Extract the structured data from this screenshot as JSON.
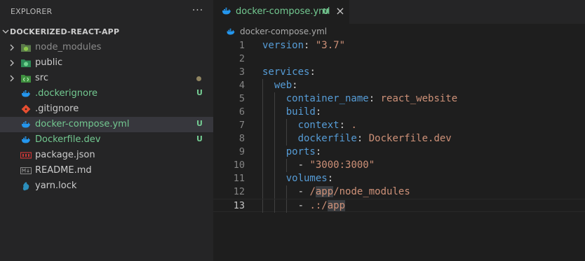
{
  "sidebar": {
    "title": "EXPLORER",
    "more_actions": "···",
    "project": "DOCKERIZED-REACT-APP",
    "items": [
      {
        "name": "node_modules",
        "color": "#8b8b8b",
        "icon": "node-modules-folder-icon",
        "folder": true
      },
      {
        "name": "public",
        "color": "#cccccc",
        "icon": "public-folder-icon",
        "folder": true
      },
      {
        "name": "src",
        "color": "#cccccc",
        "icon": "src-folder-icon",
        "folder": true,
        "dot": true
      },
      {
        "name": ".dockerignore",
        "color": "#73c991",
        "icon": "docker-icon",
        "badge": "U"
      },
      {
        "name": ".gitignore",
        "color": "#cccccc",
        "icon": "git-icon"
      },
      {
        "name": "docker-compose.yml",
        "color": "#73c991",
        "icon": "docker-icon",
        "badge": "U",
        "selected": true
      },
      {
        "name": "Dockerfile.dev",
        "color": "#73c991",
        "icon": "docker-icon",
        "badge": "U"
      },
      {
        "name": "package.json",
        "color": "#cccccc",
        "icon": "npm-icon"
      },
      {
        "name": "README.md",
        "color": "#cccccc",
        "icon": "markdown-icon"
      },
      {
        "name": "yarn.lock",
        "color": "#cccccc",
        "icon": "yarn-icon"
      }
    ]
  },
  "editor": {
    "tab": {
      "title": "docker-compose.yml",
      "badge": "U",
      "close": "×"
    },
    "breadcrumb": "docker-compose.yml",
    "current_line": 13,
    "lines": [
      {
        "n": "1",
        "guides": 0,
        "tokens": [
          {
            "t": "version",
            "c": "k"
          },
          {
            "t": ": ",
            "c": "p"
          },
          {
            "t": "\"3.7\"",
            "c": "s"
          }
        ]
      },
      {
        "n": "2",
        "guides": 0,
        "tokens": []
      },
      {
        "n": "3",
        "guides": 0,
        "tokens": [
          {
            "t": "services",
            "c": "k"
          },
          {
            "t": ":",
            "c": "p"
          }
        ]
      },
      {
        "n": "4",
        "guides": 1,
        "tokens": [
          {
            "t": "  ",
            "c": "p"
          },
          {
            "t": "web",
            "c": "k"
          },
          {
            "t": ":",
            "c": "p"
          }
        ]
      },
      {
        "n": "5",
        "guides": 2,
        "tokens": [
          {
            "t": "    ",
            "c": "p"
          },
          {
            "t": "container_name",
            "c": "k"
          },
          {
            "t": ": ",
            "c": "p"
          },
          {
            "t": "react_website",
            "c": "s"
          }
        ]
      },
      {
        "n": "6",
        "guides": 2,
        "tokens": [
          {
            "t": "    ",
            "c": "p"
          },
          {
            "t": "build",
            "c": "k"
          },
          {
            "t": ":",
            "c": "p"
          }
        ]
      },
      {
        "n": "7",
        "guides": 3,
        "tokens": [
          {
            "t": "      ",
            "c": "p"
          },
          {
            "t": "context",
            "c": "k"
          },
          {
            "t": ": ",
            "c": "p"
          },
          {
            "t": ".",
            "c": "s"
          }
        ]
      },
      {
        "n": "8",
        "guides": 3,
        "tokens": [
          {
            "t": "      ",
            "c": "p"
          },
          {
            "t": "dockerfile",
            "c": "k"
          },
          {
            "t": ": ",
            "c": "p"
          },
          {
            "t": "Dockerfile.dev",
            "c": "s"
          }
        ]
      },
      {
        "n": "9",
        "guides": 2,
        "tokens": [
          {
            "t": "    ",
            "c": "p"
          },
          {
            "t": "ports",
            "c": "k"
          },
          {
            "t": ":",
            "c": "p"
          }
        ]
      },
      {
        "n": "10",
        "guides": 3,
        "tokens": [
          {
            "t": "      ",
            "c": "p"
          },
          {
            "t": "- ",
            "c": "p"
          },
          {
            "t": "\"3000:3000\"",
            "c": "s"
          }
        ]
      },
      {
        "n": "11",
        "guides": 2,
        "tokens": [
          {
            "t": "    ",
            "c": "p"
          },
          {
            "t": "volumes",
            "c": "k"
          },
          {
            "t": ":",
            "c": "p"
          }
        ]
      },
      {
        "n": "12",
        "guides": 3,
        "tokens": [
          {
            "t": "      ",
            "c": "p"
          },
          {
            "t": "- ",
            "c": "p"
          },
          {
            "t": "/",
            "c": "s"
          },
          {
            "t": "app",
            "c": "s",
            "hl": true
          },
          {
            "t": "/node_modules",
            "c": "s"
          }
        ]
      },
      {
        "n": "13",
        "guides": 3,
        "tokens": [
          {
            "t": "      ",
            "c": "p"
          },
          {
            "t": "- ",
            "c": "p"
          },
          {
            "t": ".:/",
            "c": "s"
          },
          {
            "t": "app",
            "c": "s",
            "hl": true
          }
        ]
      }
    ]
  }
}
